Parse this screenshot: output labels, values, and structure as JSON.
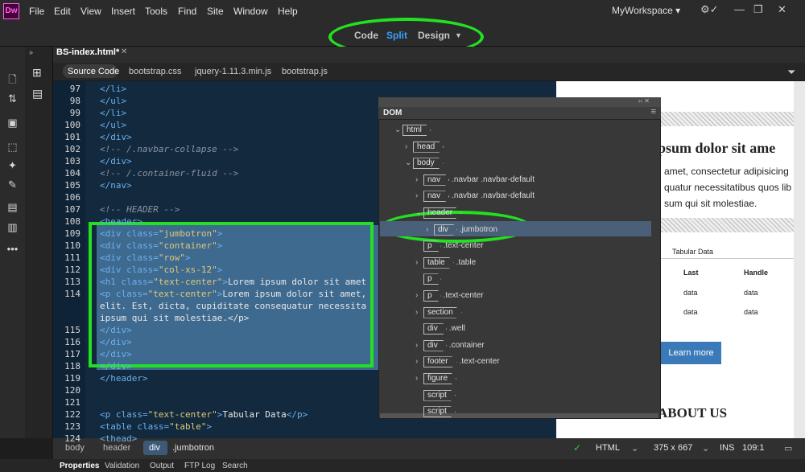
{
  "app": {
    "logo": "Dw",
    "workspace": "MyWorkspace"
  },
  "menu": [
    "File",
    "Edit",
    "View",
    "Insert",
    "Tools",
    "Find",
    "Site",
    "Window",
    "Help"
  ],
  "view": {
    "code": "Code",
    "split": "Split",
    "design": "Design"
  },
  "document": {
    "tab": "BS-index.html*",
    "related": [
      "Source Code",
      "bootstrap.css",
      "jquery-1.11.3.min.js",
      "bootstrap.js"
    ]
  },
  "code_lines": [
    {
      "n": "97",
      "t": "</li>"
    },
    {
      "n": "98",
      "t": "</ul>"
    },
    {
      "n": "99",
      "t": "</li>"
    },
    {
      "n": "100",
      "t": "</ul>"
    },
    {
      "n": "101",
      "t": "</div>"
    },
    {
      "n": "102",
      "t": "<!-- /.navbar-collapse -->"
    },
    {
      "n": "103",
      "t": "</div>"
    },
    {
      "n": "104",
      "t": "<!-- /.container-fluid -->"
    },
    {
      "n": "105",
      "t": "</nav>"
    },
    {
      "n": "106",
      "t": ""
    },
    {
      "n": "107",
      "t": "<!-- HEADER -->"
    },
    {
      "n": "108",
      "t": "<header>"
    },
    {
      "n": "109",
      "t": "<div class=\"jumbotron\">"
    },
    {
      "n": "110",
      "t": "<div class=\"container\">"
    },
    {
      "n": "111",
      "t": "<div class=\"row\">"
    },
    {
      "n": "112",
      "t": "<div class=\"col-xs-12\">"
    },
    {
      "n": "113",
      "t": "<h1 class=\"text-center\">Lorem ipsum dolor sit amet"
    },
    {
      "n": "114",
      "t": "<p class=\"text-center\">Lorem ipsum dolor sit amet,"
    },
    {
      "n": "",
      "t": "elit. Est, dicta, cupiditate consequatur necessita"
    },
    {
      "n": "",
      "t": "ipsum qui sit molestiae.</p>"
    },
    {
      "n": "115",
      "t": "</div>"
    },
    {
      "n": "116",
      "t": "</div>"
    },
    {
      "n": "117",
      "t": "</div>"
    },
    {
      "n": "118",
      "t": "</div>"
    },
    {
      "n": "119",
      "t": "</header>"
    },
    {
      "n": "120",
      "t": ""
    },
    {
      "n": "121",
      "t": ""
    },
    {
      "n": "122",
      "t": "<p class=\"text-center\">Tabular Data</p>"
    },
    {
      "n": "123",
      "t": "<table class=\"table\">"
    },
    {
      "n": "124",
      "t": "<thead>"
    }
  ],
  "dom": {
    "title": "DOM",
    "rows": [
      {
        "tag": "html",
        "cls": "",
        "d": 0,
        "c": "v"
      },
      {
        "tag": "head",
        "cls": "",
        "d": 1,
        "c": ">"
      },
      {
        "tag": "body",
        "cls": "",
        "d": 1,
        "c": "v"
      },
      {
        "tag": "nav",
        "cls": ".navbar .navbar-default",
        "d": 2,
        "c": ">"
      },
      {
        "tag": "nav",
        "cls": ".navbar .navbar-default",
        "d": 2,
        "c": ">"
      },
      {
        "tag": "header",
        "cls": "",
        "d": 2,
        "c": "v"
      },
      {
        "tag": "div",
        "cls": ".jumbotron",
        "d": 3,
        "c": ">"
      },
      {
        "tag": "p",
        "cls": ".text-center",
        "d": 2,
        "c": ""
      },
      {
        "tag": "table",
        "cls": ".table",
        "d": 2,
        "c": ">"
      },
      {
        "tag": "p",
        "cls": "",
        "d": 2,
        "c": ""
      },
      {
        "tag": "p",
        "cls": ".text-center",
        "d": 2,
        "c": ">"
      },
      {
        "tag": "section",
        "cls": "",
        "d": 2,
        "c": ">"
      },
      {
        "tag": "div",
        "cls": ".well",
        "d": 2,
        "c": ""
      },
      {
        "tag": "div",
        "cls": ".container",
        "d": 2,
        "c": ">"
      },
      {
        "tag": "footer",
        "cls": ".text-center",
        "d": 2,
        "c": ">"
      },
      {
        "tag": "figure",
        "cls": "",
        "d": 2,
        "c": ">"
      },
      {
        "tag": "script",
        "cls": "",
        "d": 2,
        "c": ""
      },
      {
        "tag": "script",
        "cls": "",
        "d": 2,
        "c": ""
      }
    ]
  },
  "live": {
    "heading": "psum dolor sit ame",
    "p1": "amet, consectetur adipisicing",
    "p2": "quatur necessitatibus quos lib",
    "p3": "sum qui sit molestiae.",
    "caption": "Tabular Data",
    "col_last": "Last",
    "col_handle": "Handle",
    "cell": "data",
    "button": "Learn more",
    "about": "ABOUT US"
  },
  "status": {
    "crumbs": [
      "body",
      "header",
      "div"
    ],
    "crumb_cls": ".jumbotron",
    "mode": "HTML",
    "size": "375 x 667",
    "ins": "INS",
    "pos": "109:1"
  },
  "bottom_tabs": [
    "Properties",
    "Validation",
    "Output",
    "FTP Log",
    "Search"
  ]
}
